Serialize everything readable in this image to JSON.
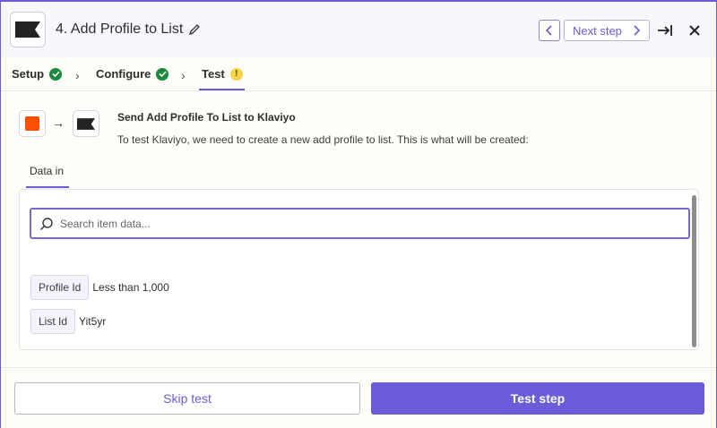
{
  "header": {
    "title": "4. Add Profile to List",
    "next_step_label": "Next step"
  },
  "steps": [
    {
      "label": "Setup",
      "status": "complete"
    },
    {
      "label": "Configure",
      "status": "complete"
    },
    {
      "label": "Test",
      "status": "warning",
      "status_glyph": "!"
    }
  ],
  "main": {
    "title": "Send Add Profile To List to Klaviyo",
    "description": "To test Klaviyo, we need to create a new add profile to list.  This is what will be created:",
    "data_tab_label": "Data in",
    "search_placeholder": "Search item data...",
    "fields": [
      {
        "label": "Profile Id",
        "value": "Less than 1,000"
      },
      {
        "label": "List Id",
        "value": "Yit5yr"
      }
    ]
  },
  "footer": {
    "skip_label": "Skip test",
    "test_label": "Test step"
  },
  "colors": {
    "accent": "#6b5dd9",
    "success": "#1b8a3e",
    "warning": "#f7d54a",
    "source_app": "#ff4f00"
  }
}
